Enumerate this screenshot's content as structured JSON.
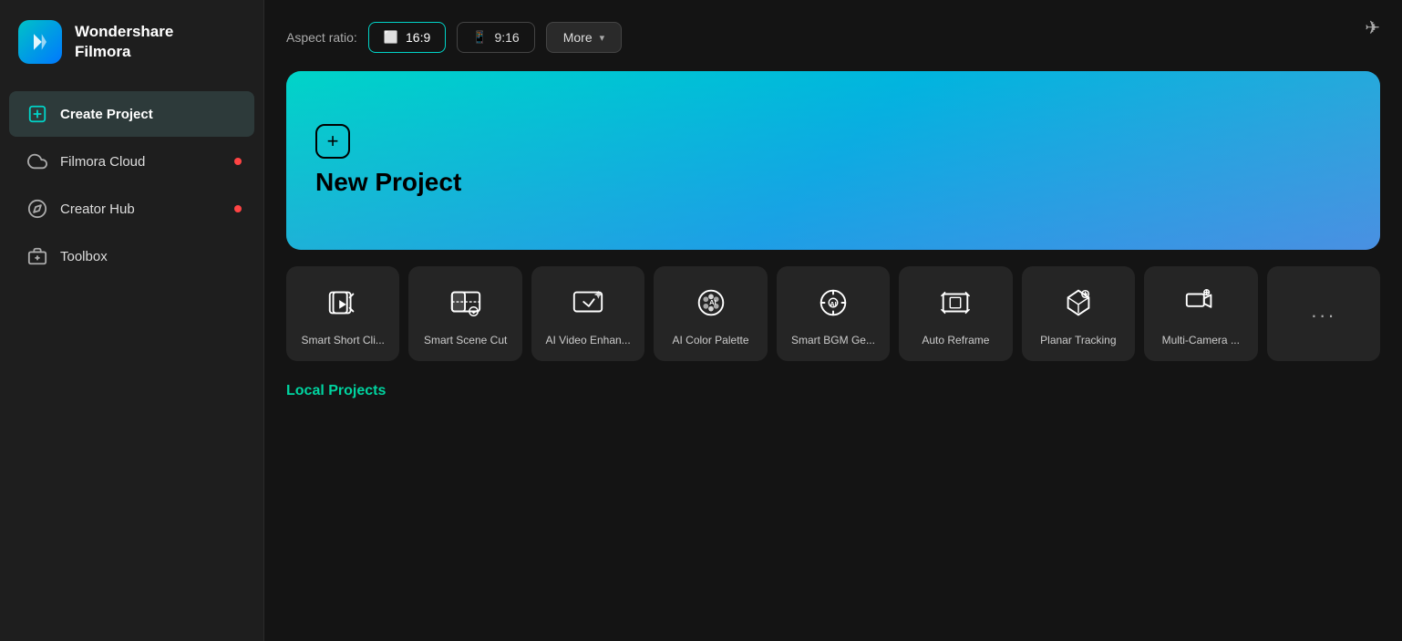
{
  "app": {
    "name": "Wondershare",
    "name2": "Filmora",
    "send_icon": "✈"
  },
  "sidebar": {
    "items": [
      {
        "id": "create-project",
        "label": "Create Project",
        "icon": "plus-square",
        "active": true,
        "dot": false
      },
      {
        "id": "filmora-cloud",
        "label": "Filmora Cloud",
        "icon": "cloud",
        "active": false,
        "dot": true
      },
      {
        "id": "creator-hub",
        "label": "Creator Hub",
        "icon": "compass",
        "active": false,
        "dot": true
      },
      {
        "id": "toolbox",
        "label": "Toolbox",
        "icon": "toolbox",
        "active": false,
        "dot": false
      }
    ]
  },
  "aspect_ratio": {
    "label": "Aspect ratio:",
    "options": [
      {
        "id": "16-9",
        "label": "16:9",
        "icon": "monitor",
        "active": true
      },
      {
        "id": "9-16",
        "label": "9:16",
        "icon": "phone",
        "active": false
      }
    ],
    "more_label": "More",
    "more_chevron": "▾"
  },
  "new_project": {
    "label": "New Project"
  },
  "tools": [
    {
      "id": "smart-short-clip",
      "label": "Smart Short Cli..."
    },
    {
      "id": "smart-scene-cut",
      "label": "Smart Scene Cut"
    },
    {
      "id": "ai-video-enhance",
      "label": "AI Video Enhan..."
    },
    {
      "id": "ai-color-palette",
      "label": "AI Color Palette"
    },
    {
      "id": "smart-bgm",
      "label": "Smart BGM Ge..."
    },
    {
      "id": "auto-reframe",
      "label": "Auto Reframe"
    },
    {
      "id": "planar-tracking",
      "label": "Planar Tracking"
    },
    {
      "id": "multi-camera",
      "label": "Multi-Camera ..."
    },
    {
      "id": "more-tools",
      "label": "···"
    }
  ],
  "local_projects": {
    "title": "Local Projects"
  }
}
